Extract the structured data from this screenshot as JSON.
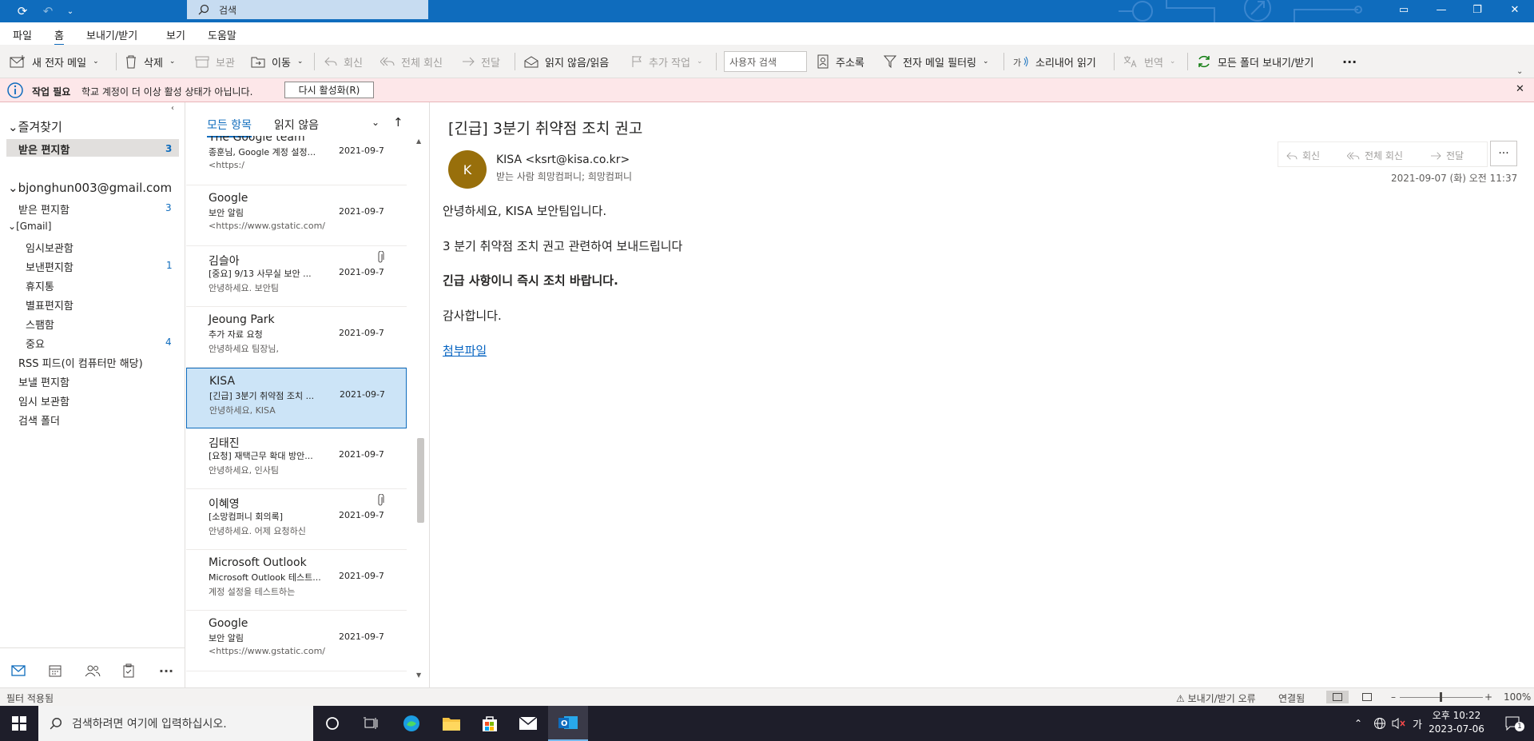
{
  "titlebar": {
    "search_placeholder": "검색"
  },
  "menu": {
    "tabs": [
      {
        "label": "파일"
      },
      {
        "label": "홈"
      },
      {
        "label": "보내기/받기"
      },
      {
        "label": "보기"
      },
      {
        "label": "도움말"
      }
    ],
    "active_tab": "홈"
  },
  "ribbon": {
    "new_mail": "새 전자 메일",
    "delete": "삭제",
    "archive": "보관",
    "move": "이동",
    "reply": "회신",
    "reply_all": "전체 회신",
    "forward": "전달",
    "read_unread": "읽지 않음/읽음",
    "followup": "추가 작업",
    "people_search_placeholder": "사용자 검색",
    "address_book": "주소록",
    "filter_email": "전자 메일 필터링",
    "read_aloud": "소리내어 읽기",
    "translate": "번역",
    "send_receive_all": "모든 폴더 보내기/받기",
    "more": "···"
  },
  "infobar": {
    "title": "작업 필요",
    "message": "학교 계정이 더 이상 활성 상태가 아닙니다.",
    "button": "다시 활성화(R)"
  },
  "folders": {
    "favorites_header": "즐겨찾기",
    "favorites": [
      {
        "name": "받은 편지함",
        "count": "3"
      }
    ],
    "account": "bjonghun003@gmail.com",
    "inbox": {
      "name": "받은 편지함",
      "count": "3"
    },
    "gmail_group": "[Gmail]",
    "gmail_items": [
      {
        "name": "임시보관함",
        "count": ""
      },
      {
        "name": "보낸편지함",
        "count": "1"
      },
      {
        "name": "휴지통",
        "count": ""
      },
      {
        "name": "별표편지함",
        "count": ""
      },
      {
        "name": "스팸함",
        "count": ""
      },
      {
        "name": "중요",
        "count": "4"
      }
    ],
    "other_items": [
      {
        "name": "RSS 피드(이 컴퓨터만 해당)"
      },
      {
        "name": "보낼 편지함"
      },
      {
        "name": "임시 보관함"
      },
      {
        "name": "검색 폴더"
      }
    ]
  },
  "message_list": {
    "filter_all": "모든 항목",
    "filter_unread": "읽지 않음",
    "messages": [
      {
        "sender": "The Google team",
        "subject": "종훈님, Google 계정 설정...",
        "preview": "<https:/",
        "date": "2021-09-7"
      },
      {
        "sender": "Google",
        "subject": "보안 알림",
        "preview": "<https://www.gstatic.com/",
        "date": "2021-09-7"
      },
      {
        "sender": "김슬아",
        "subject": "[중요] 9/13 사무실 보안 ...",
        "preview": "안녕하세요. 보안팀",
        "date": "2021-09-7"
      },
      {
        "sender": "Jeoung Park",
        "subject": "추가 자료 요청",
        "preview": "안녕하세요 팀장님,",
        "date": "2021-09-7"
      },
      {
        "sender": "KISA",
        "subject": "[긴급] 3분기 취약점 조치 ...",
        "preview": "안녕하세요, KISA",
        "date": "2021-09-7"
      },
      {
        "sender": "김태진",
        "subject": "[요청] 재택근무 확대 방안...",
        "preview": "안녕하세요, 인사팀",
        "date": "2021-09-7"
      },
      {
        "sender": "이혜영",
        "subject": "[소망컴퍼니 회의록]",
        "preview": "안녕하세요.  어제 요청하신",
        "date": "2021-09-7"
      },
      {
        "sender": "Microsoft Outlook",
        "subject": "Microsoft Outlook 테스트...",
        "preview": "계정 설정을 테스트하는",
        "date": "2021-09-7"
      },
      {
        "sender": "Google",
        "subject": "보안 알림",
        "preview": "<https://www.gstatic.com/",
        "date": "2021-09-7"
      }
    ]
  },
  "reading": {
    "subject": "[긴급] 3분기 취약점 조치 권고",
    "avatar_initial": "K",
    "from": "KISA <ksrt@kisa.co.kr>",
    "to": "받는 사람   희망컴퍼니; 희망컴퍼니",
    "reply": "회신",
    "reply_all": "전체 회신",
    "forward": "전달",
    "more": "···",
    "date": "2021-09-07 (화) 오전 11:37",
    "body": [
      "안녕하세요, KISA 보안팀입니다.",
      "3 분기 취약점 조치 권고 관련하여 보내드립니다",
      "긴급 사항이니 즉시 조치 바랍니다.",
      "감사합니다."
    ],
    "attachment_link": "첨부파일"
  },
  "statusbar": {
    "filter": "필터 적용됨",
    "error": "보내기/받기 오류",
    "connected": "연결됨",
    "zoom": "100%"
  },
  "taskbar": {
    "search_placeholder": "검색하려면 여기에 입력하십시오.",
    "time": "오후 10:22",
    "date": "2023-07-06",
    "ime": "가",
    "notification_count": "1"
  },
  "colors": {
    "accent": "#0f6cbd",
    "selected_row": "#cce4f7",
    "infobar": "#fde7e9",
    "avatar": "#986f0b"
  }
}
